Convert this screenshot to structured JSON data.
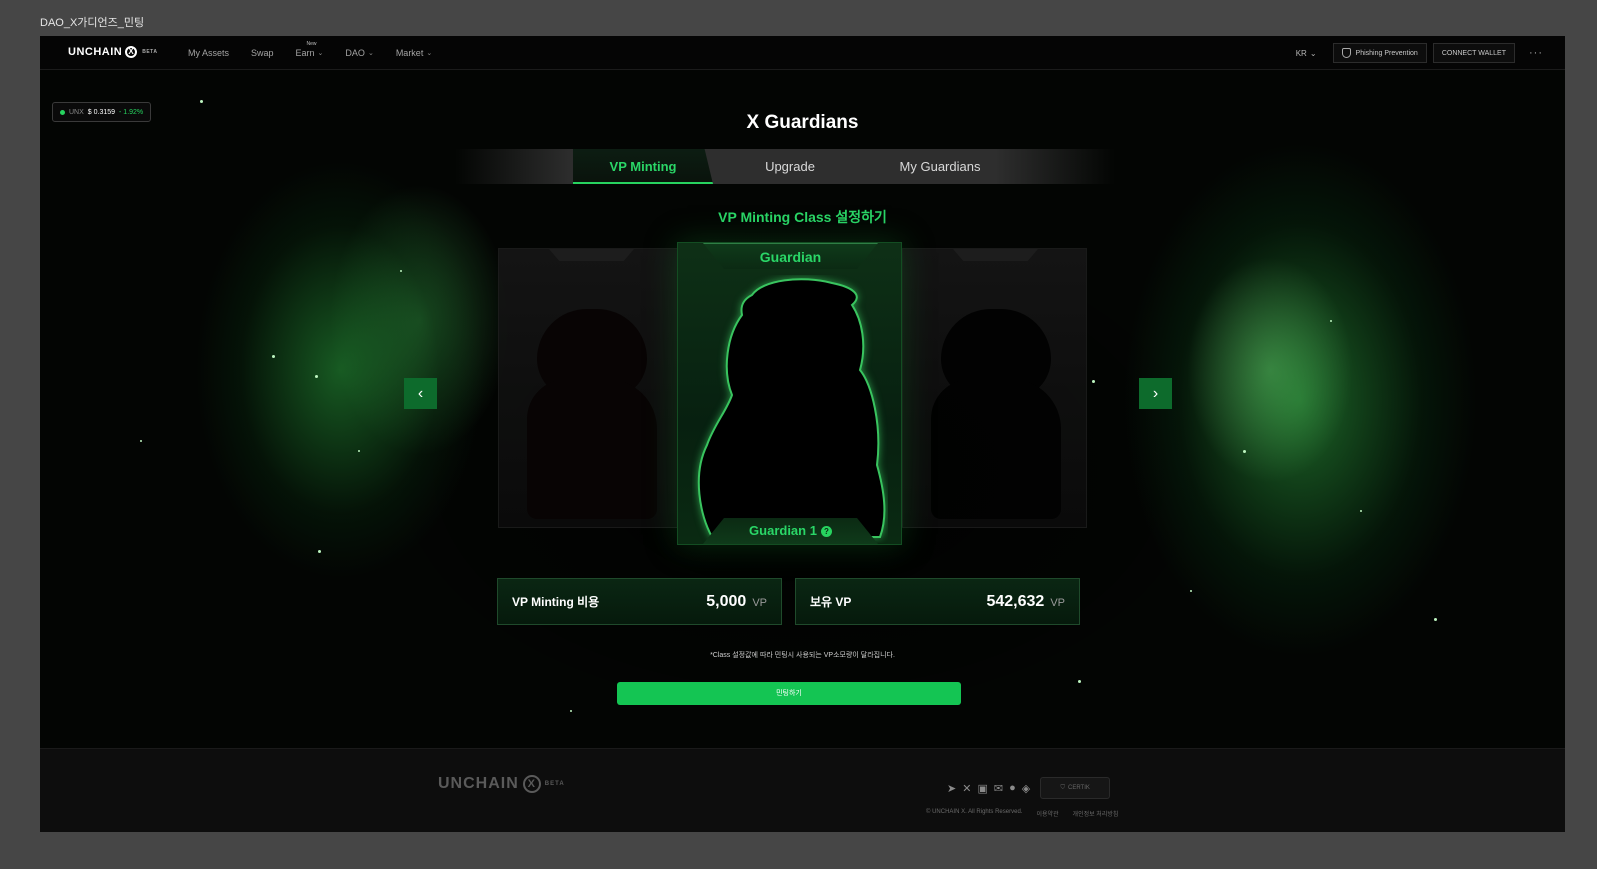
{
  "frame_title": "DAO_X가디언즈_민팅",
  "nav": {
    "logo": "UNCHAIN",
    "logo_badge": "BETA",
    "menu": [
      {
        "label": "My Assets"
      },
      {
        "label": "Swap"
      },
      {
        "label": "Earn",
        "badge": "New"
      },
      {
        "label": "DAO"
      },
      {
        "label": "Market"
      }
    ],
    "lang": "KR",
    "phishing": "Phishing Prevention",
    "connect": "CONNECT WALLET",
    "more": "···"
  },
  "price": {
    "symbol": "UNX",
    "value": "$ 0.3159",
    "change": "- 1.92%"
  },
  "page": {
    "title": "X Guardians",
    "tabs": [
      {
        "label": "VP Minting"
      },
      {
        "label": "Upgrade"
      },
      {
        "label": "My Guardians"
      }
    ],
    "active_tab": "VP Minting",
    "subtitle": "VP Minting Class 설정하기",
    "card": {
      "class": "Guardian",
      "level": "Guardian 1",
      "help": "?"
    },
    "cost": {
      "label": "VP Minting 비용",
      "value": "5,000",
      "unit": "VP"
    },
    "balance": {
      "label": "보유 VP",
      "value": "542,632",
      "unit": "VP"
    },
    "note": "*Class 설정값에 따라 민팅시 사용되는 VP소모량이 달라집니다.",
    "mint_button": "민팅하기"
  },
  "footer": {
    "logo": "UNCHAIN",
    "certik": "CERTIK",
    "copyright": "© UNCHAIN X. All Rights Reserved.",
    "terms": "이용약관",
    "privacy": "개인정보 처리방침"
  },
  "colors": {
    "accent": "#27d35f",
    "button": "#14c553",
    "background": "#050505"
  }
}
